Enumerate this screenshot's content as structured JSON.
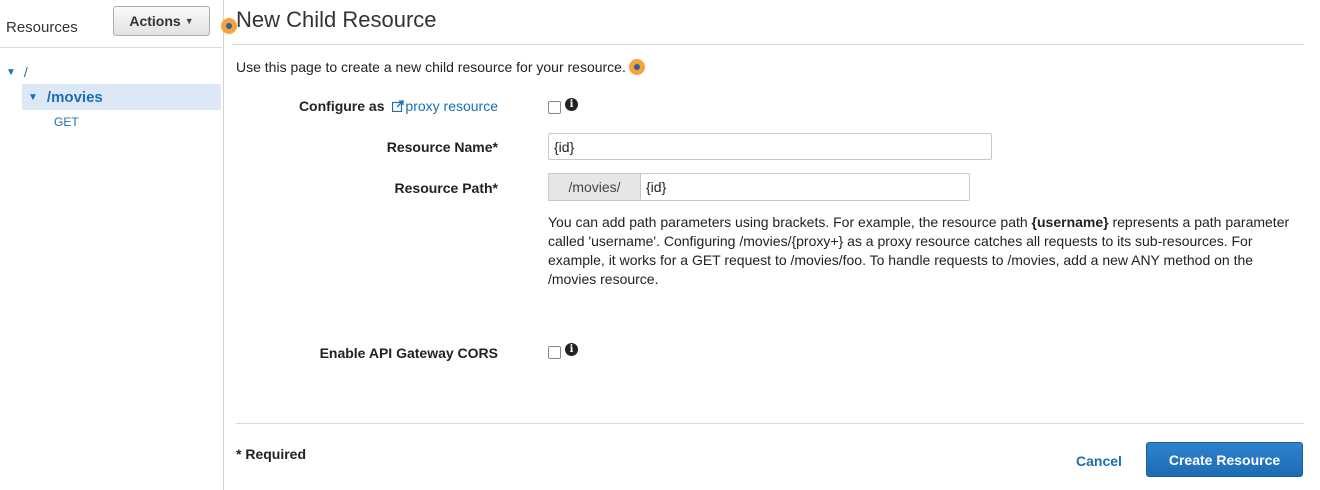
{
  "sidebar": {
    "title": "Resources",
    "actions_label": "Actions",
    "tree": {
      "root": "/",
      "child": "/movies",
      "method": "GET"
    }
  },
  "main": {
    "title": "New Child Resource",
    "intro": "Use this page to create a new child resource for your resource.",
    "form": {
      "configure_label": "Configure as",
      "proxy_link": "proxy resource",
      "resource_name_label": "Resource Name*",
      "resource_name_value": "{id}",
      "resource_path_label": "Resource Path*",
      "resource_path_prefix": "/movies/",
      "resource_path_value": "{id}",
      "help_pre": "You can add path parameters using brackets. For example, the resource path ",
      "help_bold": "{username}",
      "help_post": " represents a path parameter called 'username'. Configuring /movies/{proxy+} as a proxy resource catches all requests to its sub-resources. For example, it works for a GET request to /movies/foo. To handle requests to /movies, add a new ANY method on the /movies resource.",
      "cors_label": "Enable API Gateway CORS"
    },
    "footer": {
      "required": "* Required",
      "cancel": "Cancel",
      "create": "Create Resource"
    }
  },
  "colors": {
    "link": "#1a6fb4",
    "primary_button": "#1e6bb5",
    "selected_bg": "#dce8f5",
    "highlight_dot": "#f5a33a"
  },
  "icons": {
    "tree_toggle": "caret-down-icon",
    "info": "info-icon",
    "external_link": "external-link-icon",
    "highlight": "highlight-dot-icon"
  }
}
